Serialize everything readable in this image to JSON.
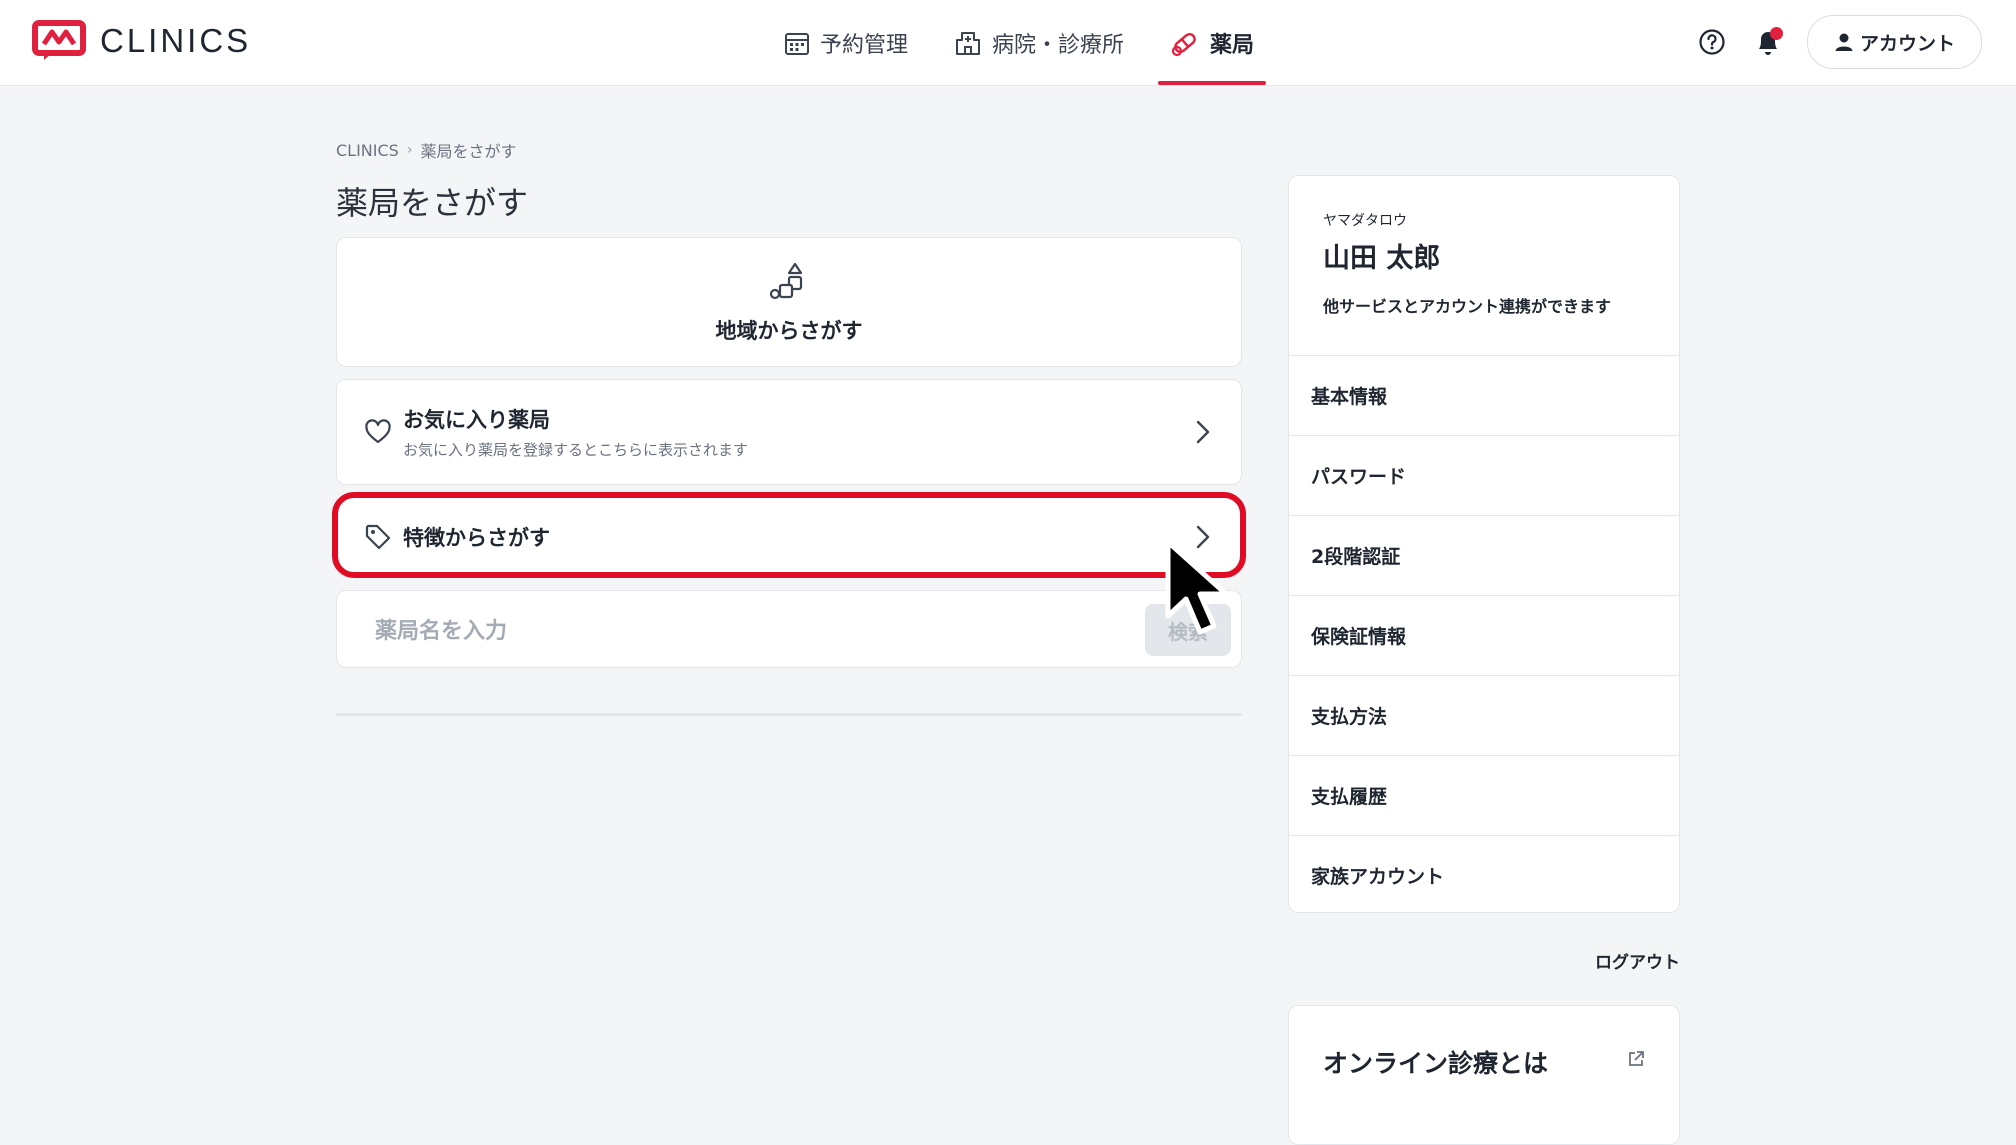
{
  "header": {
    "logo_text": "CLINICS",
    "nav": [
      {
        "label": "予約管理",
        "icon": "calendar-icon"
      },
      {
        "label": "病院・診療所",
        "icon": "hospital-icon"
      },
      {
        "label": "薬局",
        "icon": "pill-icon",
        "active": true
      }
    ],
    "account_label": "アカウント"
  },
  "breadcrumb": {
    "root": "CLINICS",
    "current": "薬局をさがす"
  },
  "page_title": "薬局をさがす",
  "region_search": {
    "label": "地域からさがす",
    "icon": "map-pin-icon"
  },
  "favorites": {
    "title": "お気に入り薬局",
    "subtitle": "お気に入り薬局を登録するとこちらに表示されます",
    "icon": "heart-icon"
  },
  "feature_search": {
    "title": "特徴からさがす",
    "icon": "tag-icon"
  },
  "name_search": {
    "placeholder": "薬局名を入力",
    "button": "検索"
  },
  "sidebar": {
    "kana": "ヤマダタロウ",
    "name": "山田 太郎",
    "link_note": "他サービスとアカウント連携ができます",
    "menu": [
      "基本情報",
      "パスワード",
      "2段階認証",
      "保険証情報",
      "支払方法",
      "支払履歴",
      "家族アカウント"
    ],
    "logout": "ログアウト"
  },
  "online": {
    "title": "オンライン診療とは"
  },
  "colors": {
    "accent": "#e0203f",
    "highlight": "#e00b24",
    "background": "#f4f5f7"
  }
}
